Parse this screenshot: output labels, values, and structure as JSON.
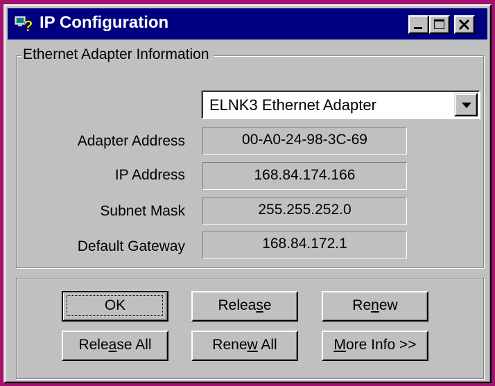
{
  "window": {
    "title": "IP Configuration",
    "icon": "ip-config-app-icon",
    "controls": [
      "minimize-icon",
      "maximize-icon",
      "close-icon"
    ]
  },
  "adapter_group": {
    "label": "Ethernet  Adapter Information",
    "selected_adapter": "ELNK3 Ethernet Adapter",
    "fields": {
      "adapter_address": {
        "label": "Adapter Address",
        "value": "00-A0-24-98-3C-69"
      },
      "ip_address": {
        "label": "IP Address",
        "value": "168.84.174.166"
      },
      "subnet_mask": {
        "label": "Subnet Mask",
        "value": "255.255.252.0"
      },
      "default_gateway": {
        "label": "Default Gateway",
        "value": "168.84.172.1"
      }
    }
  },
  "buttons": {
    "ok": "OK",
    "release": {
      "pre": "Relea",
      "key": "s",
      "post": "e"
    },
    "renew": {
      "pre": "Re",
      "key": "n",
      "post": "ew"
    },
    "release_all": {
      "pre": "Rele",
      "key": "a",
      "post": "se All"
    },
    "renew_all": {
      "pre": "Rene",
      "key": "w",
      "post": " All"
    },
    "more_info": {
      "pre": "",
      "key": "M",
      "post": "ore Info >>"
    }
  },
  "colors": {
    "desktop": "#a4126f",
    "titlebar": "#000080",
    "face": "#c0c0c0"
  }
}
